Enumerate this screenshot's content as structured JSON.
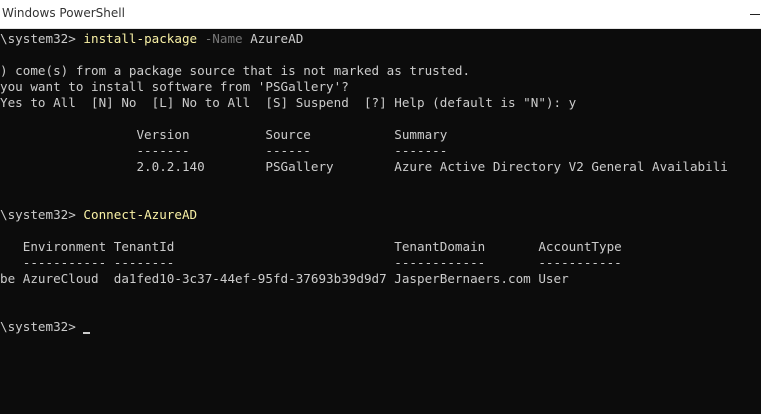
{
  "window": {
    "title": "Windows PowerShell"
  },
  "console": {
    "lines": [
      {
        "segments": [
          {
            "text": "\\system32> "
          },
          {
            "text": "install-package",
            "style": "cmd"
          },
          {
            "text": " -Name",
            "style": "param"
          },
          {
            "text": " AzureAD"
          }
        ]
      },
      {
        "segments": []
      },
      {
        "segments": [
          {
            "text": ") come(s) from a package source that is not marked as trusted."
          }
        ]
      },
      {
        "segments": [
          {
            "text": "you want to install software from 'PSGallery'?"
          }
        ]
      },
      {
        "segments": [
          {
            "text": "Yes to All  [N] No  [L] No to All  [S] Suspend  [?] Help (default is \"N\"): y"
          }
        ]
      },
      {
        "segments": []
      },
      {
        "segments": [
          {
            "text": "                  Version          Source           Summary"
          }
        ]
      },
      {
        "segments": [
          {
            "text": "                  -------          ------           -------"
          }
        ]
      },
      {
        "segments": [
          {
            "text": "                  2.0.2.140        PSGallery        Azure Active Directory V2 General Availabili"
          }
        ]
      },
      {
        "segments": []
      },
      {
        "segments": []
      },
      {
        "segments": [
          {
            "text": "\\system32> "
          },
          {
            "text": "Connect-AzureAD",
            "style": "cmd"
          }
        ]
      },
      {
        "segments": []
      },
      {
        "segments": [
          {
            "text": "   Environment TenantId                             TenantDomain       AccountType"
          }
        ]
      },
      {
        "segments": [
          {
            "text": "   ----------- --------                             ------------       -----------"
          }
        ]
      },
      {
        "segments": [
          {
            "text": "be AzureCloud  da1fed10-3c37-44ef-95fd-37693b39d9d7 JasperBernaers.com User"
          }
        ]
      },
      {
        "segments": []
      },
      {
        "segments": []
      },
      {
        "segments": [
          {
            "text": "\\system32> "
          }
        ],
        "cursor": true
      }
    ]
  }
}
